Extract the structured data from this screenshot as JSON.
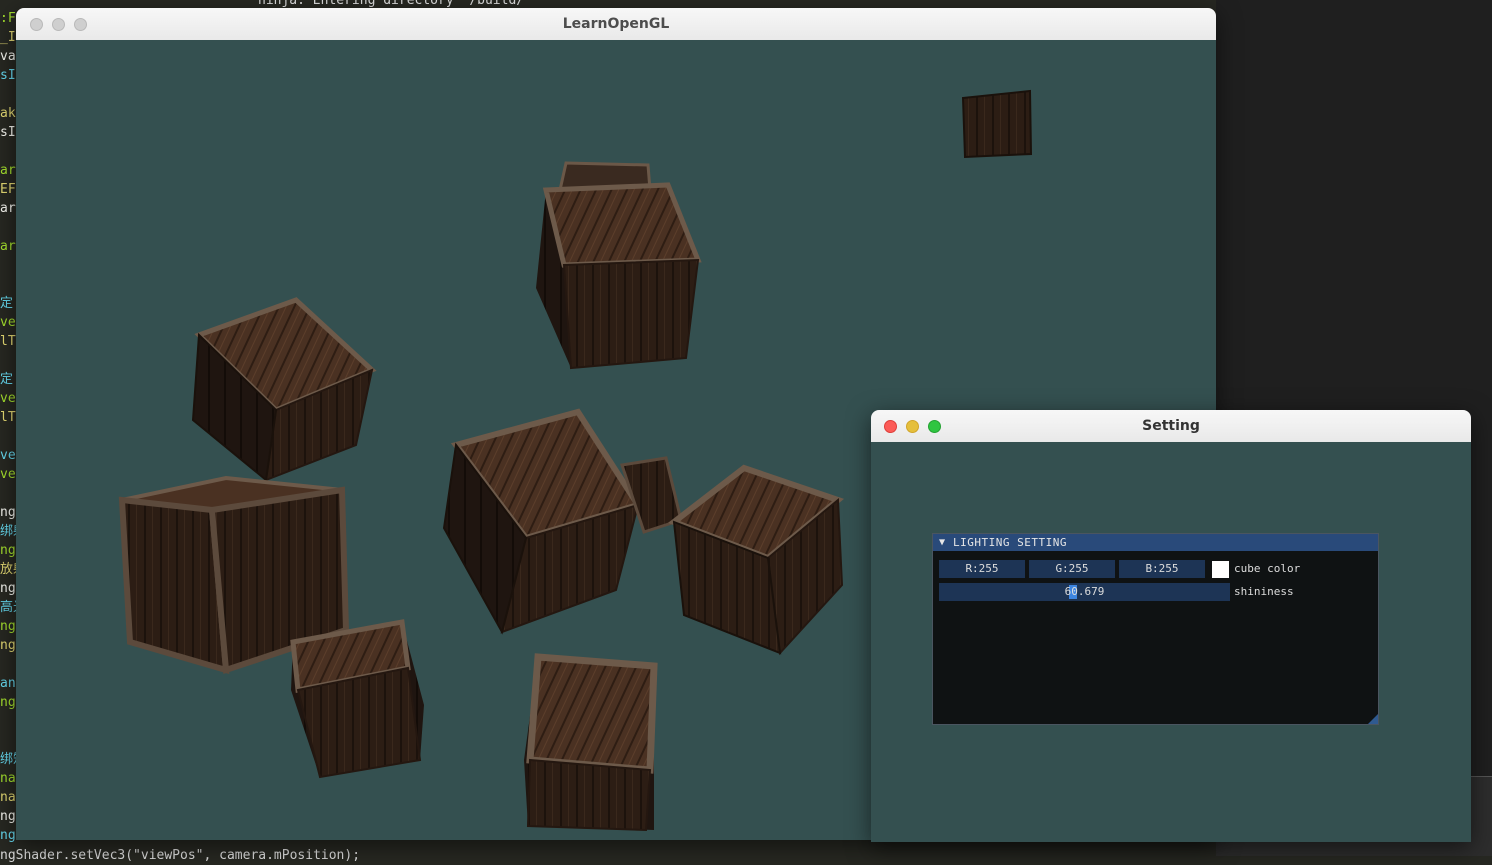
{
  "main_window": {
    "title": "LearnOpenGL",
    "clear_color": "#345050"
  },
  "setting_window": {
    "title": "Setting",
    "panel": {
      "header": "LIGHTING SETTING",
      "cube_color": {
        "r": "R:255",
        "g": "G:255",
        "b": "B:255",
        "swatch": "#ffffff",
        "label": "cube color"
      },
      "shininess": {
        "value": "60.679",
        "label": "shininess"
      }
    }
  },
  "editor_bg": {
    "top_line": "ninja: Entering directory `/build/",
    "bottom_line": "ngShader.setVec3(\"viewPos\", camera.mPosition);",
    "gutter": [
      ":F",
      "_Im",
      "vap",
      "sIN",
      "",
      "ake",
      "sI",
      "",
      "arC",
      "EF",
      "ar(",
      "",
      "ar(",
      "",
      "",
      "定 ",
      "ve",
      "lTe",
      "",
      "定 ",
      "ve",
      "lTe",
      "",
      "vec",
      "vec",
      "",
      "ng",
      "绑射",
      "ng",
      "放射",
      "ng",
      "高光",
      "ng",
      "ng",
      "",
      "ani",
      "ng",
      "",
      "",
      "绑矩",
      "nat",
      "nat",
      "ng",
      "ng"
    ]
  },
  "colors": {
    "viewport": "#345050",
    "imgui_header": "#294a7a",
    "imgui_field": "#1d3455",
    "traffic_close": "#fc5b57",
    "traffic_min": "#e5bf3c",
    "traffic_max": "#2fc541"
  }
}
